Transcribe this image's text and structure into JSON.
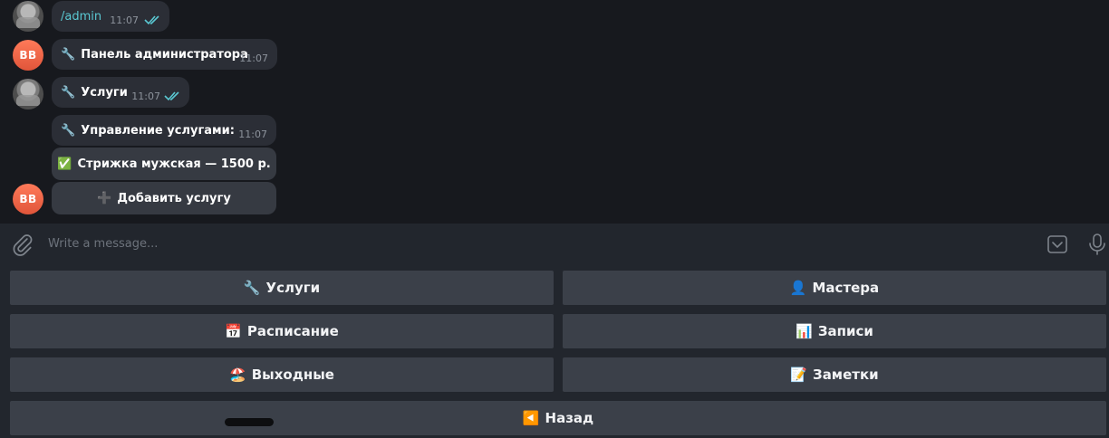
{
  "messages": [
    {
      "text": "/admin",
      "time": "11:07",
      "ticks": "read"
    },
    {
      "emoji": "🔧",
      "text": "Панель администратора",
      "time": "11:07"
    },
    {
      "emoji": "🔧",
      "text": "Услуги",
      "time": "11:07",
      "ticks": "read"
    },
    {
      "emoji": "🔧",
      "text": "Управление услугами:",
      "time": "11:07"
    }
  ],
  "bot_avatar_initials": "BB",
  "inline_buttons": [
    {
      "emoji": "✅",
      "label": "Стрижка мужская — 1500 р."
    },
    {
      "emoji": "➕",
      "label": "Добавить услугу"
    }
  ],
  "composer": {
    "placeholder": "Write a message..."
  },
  "keyboard": [
    {
      "emoji": "🔧",
      "label": "Услуги"
    },
    {
      "emoji": "👤",
      "label": "Мастера"
    },
    {
      "emoji": "📅",
      "label": "Расписание"
    },
    {
      "emoji": "📊",
      "label": "Записи"
    },
    {
      "emoji": "🏖️",
      "label": "Выходные"
    },
    {
      "emoji": "📝",
      "label": "Заметки"
    },
    {
      "emoji": "◀️",
      "label": "Назад"
    }
  ],
  "colors": {
    "accent": "#5ac8d2",
    "avatar": "#ef6a4a",
    "background": "#17191e",
    "bubble": "#2b2e36"
  }
}
